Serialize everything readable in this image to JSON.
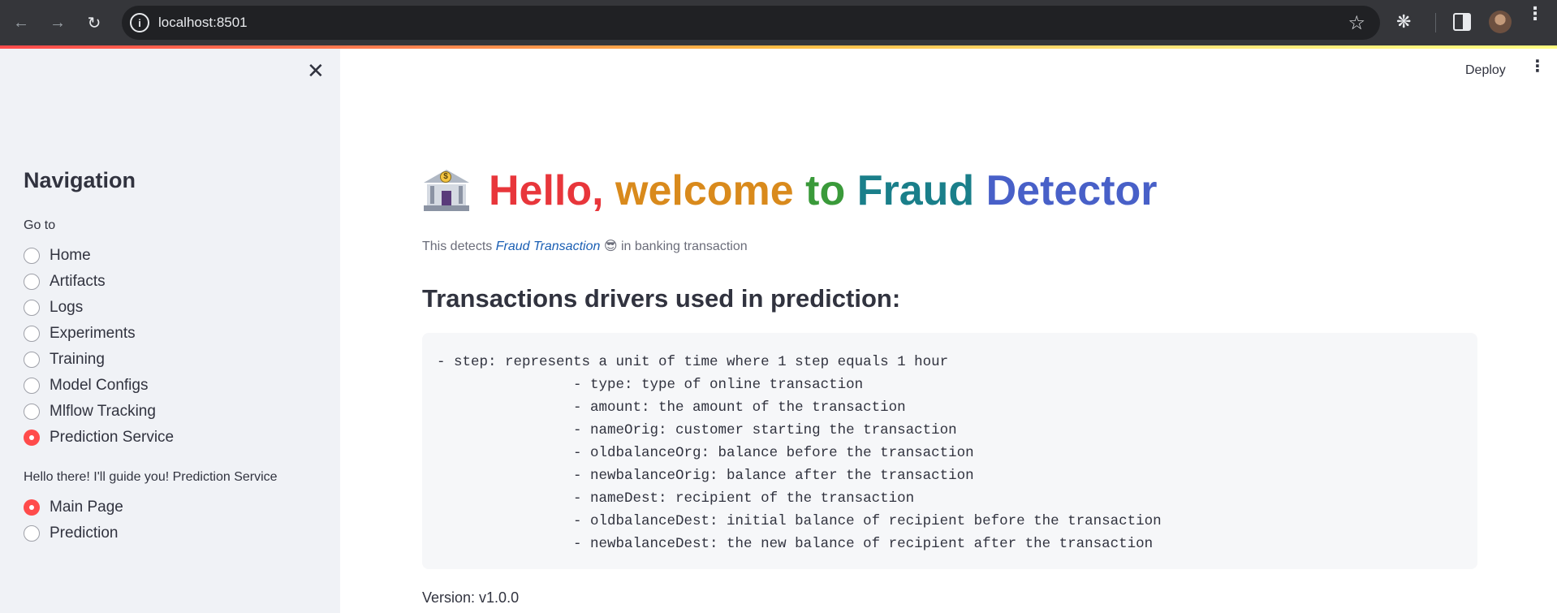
{
  "browser": {
    "url": "localhost:8501"
  },
  "sidebar": {
    "heading": "Navigation",
    "goto_label": "Go to",
    "nav_items": [
      {
        "label": "Home",
        "selected": false
      },
      {
        "label": "Artifacts",
        "selected": false
      },
      {
        "label": "Logs",
        "selected": false
      },
      {
        "label": "Experiments",
        "selected": false
      },
      {
        "label": "Training",
        "selected": false
      },
      {
        "label": "Model Configs",
        "selected": false
      },
      {
        "label": "Mlflow Tracking",
        "selected": false
      },
      {
        "label": "Prediction Service",
        "selected": true
      }
    ],
    "guide_label": "Hello there! I'll guide you! Prediction Service",
    "sub_items": [
      {
        "label": "Main Page",
        "selected": true
      },
      {
        "label": "Prediction",
        "selected": false
      }
    ],
    "accent_color": "#ff4b4b"
  },
  "header": {
    "deploy_label": "Deploy"
  },
  "main": {
    "title_words": [
      "Hello,",
      "welcome",
      "to",
      "Fraud",
      "Detector"
    ],
    "subtitle_prefix": "This detects",
    "subtitle_emphasis": "Fraud Transaction",
    "subtitle_emoji": "😎",
    "subtitle_suffix": "in banking transaction",
    "section_heading": "Transactions drivers used in prediction:",
    "code_lines": [
      "- step: represents a unit of time where 1 step equals 1 hour",
      "                - type: type of online transaction",
      "                - amount: the amount of the transaction",
      "                - nameOrig: customer starting the transaction",
      "                - oldbalanceOrg: balance before the transaction",
      "                - newbalanceOrig: balance after the transaction",
      "                - nameDest: recipient of the transaction",
      "                - oldbalanceDest: initial balance of recipient before the transaction",
      "                - newbalanceDest: the new balance of recipient after the transaction"
    ],
    "version": "Version: v1.0.0"
  }
}
